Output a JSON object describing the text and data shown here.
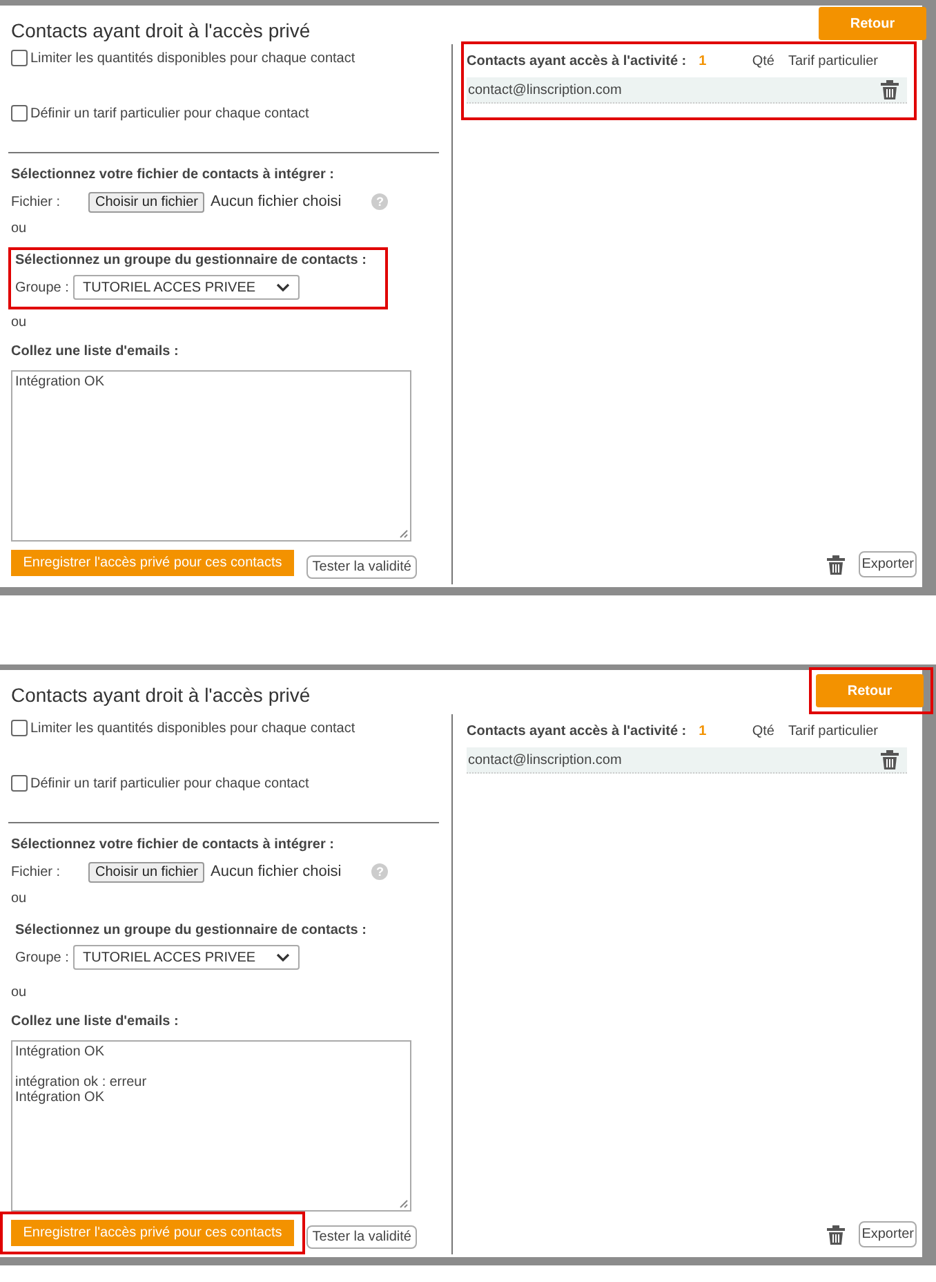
{
  "shots": [
    {
      "title": "Contacts ayant droit à l'accès privé",
      "back_button": {
        "label": "Retour",
        "highlighted": false
      },
      "options": [
        {
          "label": "Limiter les quantités disponibles pour chaque contact",
          "checked": false
        },
        {
          "label": "Définir un tarif particulier pour chaque contact",
          "checked": false
        }
      ],
      "file_section": {
        "heading": "Sélectionnez votre fichier de contacts à intégrer :",
        "label": "Fichier :",
        "button": "Choisir un fichier",
        "status": "Aucun fichier choisi",
        "help": "?"
      },
      "or_1": "ou",
      "group_section": {
        "heading": "Sélectionnez un groupe du gestionnaire de contacts :",
        "label": "Groupe :",
        "value": "TUTORIEL ACCES PRIVEE",
        "highlighted": true
      },
      "or_2": "ou",
      "paste_section": {
        "heading": "Collez une liste d'emails :",
        "value": "Intégration OK"
      },
      "save_button": {
        "label": "Enregistrer l'accès privé pour ces contacts",
        "highlighted": false
      },
      "test_button": "Tester la validité",
      "contacts_panel": {
        "heading": "Contacts ayant accès à l'activité :",
        "count": "1",
        "columns": [
          "Qté",
          "Tarif particulier"
        ],
        "rows": [
          {
            "email": "contact@linscription.com"
          }
        ],
        "highlighted": true
      },
      "export_button": "Exporter"
    },
    {
      "title": "Contacts ayant droit à l'accès privé",
      "back_button": {
        "label": "Retour",
        "highlighted": true
      },
      "options": [
        {
          "label": "Limiter les quantités disponibles pour chaque contact",
          "checked": false
        },
        {
          "label": "Définir un tarif particulier pour chaque contact",
          "checked": false
        }
      ],
      "file_section": {
        "heading": "Sélectionnez votre fichier de contacts à intégrer :",
        "label": "Fichier :",
        "button": "Choisir un fichier",
        "status": "Aucun fichier choisi",
        "help": "?"
      },
      "or_1": "ou",
      "group_section": {
        "heading": "Sélectionnez un groupe du gestionnaire de contacts :",
        "label": "Groupe :",
        "value": "TUTORIEL ACCES PRIVEE",
        "highlighted": false
      },
      "or_2": "ou",
      "paste_section": {
        "heading": "Collez une liste d'emails :",
        "value": "Intégration OK\n\nintégration ok : erreur\nIntégration OK"
      },
      "save_button": {
        "label": "Enregistrer l'accès privé pour ces contacts",
        "highlighted": true
      },
      "test_button": "Tester la validité",
      "contacts_panel": {
        "heading": "Contacts ayant accès à l'activité :",
        "count": "1",
        "columns": [
          "Qté",
          "Tarif particulier"
        ],
        "rows": [
          {
            "email": "contact@linscription.com"
          }
        ],
        "highlighted": false
      },
      "export_button": "Exporter"
    }
  ]
}
